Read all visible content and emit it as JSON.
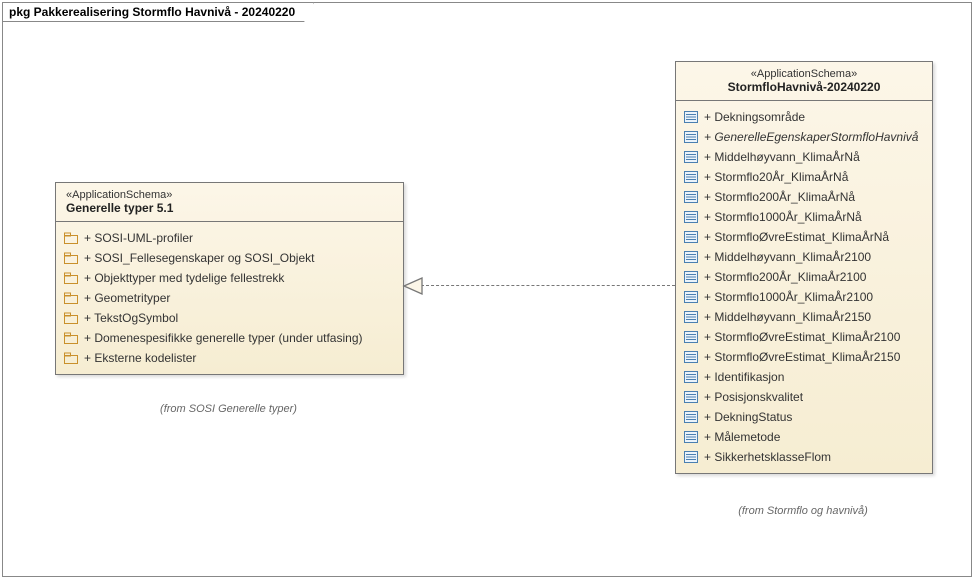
{
  "frame": {
    "title": "pkg Pakkerealisering Stormflo Havnivå - 20240220"
  },
  "left_package": {
    "stereotype": "«ApplicationSchema»",
    "name": "Generelle typer 5.1",
    "items": [
      {
        "icon": "folder",
        "label": "+ SOSI-UML-profiler"
      },
      {
        "icon": "folder",
        "label": "+ SOSI_Fellesegenskaper og SOSI_Objekt"
      },
      {
        "icon": "folder",
        "label": "+ Objekttyper med tydelige fellestrekk"
      },
      {
        "icon": "folder",
        "label": "+ Geometrityper"
      },
      {
        "icon": "folder",
        "label": "+ TekstOgSymbol"
      },
      {
        "icon": "folder",
        "label": "+ Domenespesifikke generelle typer (under utfasing)"
      },
      {
        "icon": "folder",
        "label": "+ Eksterne kodelister"
      }
    ],
    "from": "(from SOSI Generelle typer)"
  },
  "right_package": {
    "stereotype": "«ApplicationSchema»",
    "name": "StormfloHavnivå-20240220",
    "items": [
      {
        "icon": "element",
        "label": "+ Dekningsområde"
      },
      {
        "icon": "element",
        "label": "+ GenerelleEgenskaperStormfloHavnivå",
        "italic": true
      },
      {
        "icon": "element",
        "label": "+ Middelhøyvann_KlimaÅrNå"
      },
      {
        "icon": "element",
        "label": "+ Stormflo20År_KlimaÅrNå"
      },
      {
        "icon": "element",
        "label": "+ Stormflo200År_KlimaÅrNå"
      },
      {
        "icon": "element",
        "label": "+ Stormflo1000År_KlimaÅrNå"
      },
      {
        "icon": "element",
        "label": "+ StormfloØvreEstimat_KlimaÅrNå"
      },
      {
        "icon": "element",
        "label": "+ Middelhøyvann_KlimaÅr2100"
      },
      {
        "icon": "element",
        "label": "+ Stormflo200År_KlimaÅr2100"
      },
      {
        "icon": "element",
        "label": "+ Stormflo1000År_KlimaÅr2100"
      },
      {
        "icon": "element",
        "label": "+ Middelhøyvann_KlimaÅr2150"
      },
      {
        "icon": "element",
        "label": "+ StormfloØvreEstimat_KlimaÅr2100"
      },
      {
        "icon": "element",
        "label": "+ StormfloØvreEstimat_KlimaÅr2150"
      },
      {
        "icon": "element",
        "label": "+ Identifikasjon"
      },
      {
        "icon": "element",
        "label": "+ Posisjonskvalitet"
      },
      {
        "icon": "element",
        "label": "+ DekningStatus"
      },
      {
        "icon": "element",
        "label": "+ Målemetode"
      },
      {
        "icon": "element",
        "label": "+ SikkerhetsklasseFlom"
      }
    ],
    "from": "(from Stormflo og havnivå)"
  }
}
